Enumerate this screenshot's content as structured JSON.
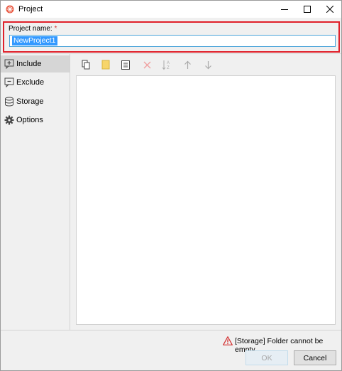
{
  "window": {
    "title": "Project",
    "icon": "app-logo-icon",
    "controls": [
      "minimize-icon",
      "maximize-icon",
      "close-icon"
    ]
  },
  "project_name": {
    "label": "Project name:",
    "required_mark": "*",
    "value": "NewProject1"
  },
  "sidebar": {
    "items": [
      {
        "label": "Include",
        "icon": "include-icon",
        "selected": true
      },
      {
        "label": "Exclude",
        "icon": "exclude-icon",
        "selected": false
      },
      {
        "label": "Storage",
        "icon": "storage-icon",
        "selected": false
      },
      {
        "label": "Options",
        "icon": "gear-icon",
        "selected": false
      }
    ]
  },
  "toolbar": {
    "tools": [
      "copy-icon",
      "folder-icon",
      "list-icon",
      "delete-icon",
      "sort-az-icon",
      "move-up-icon",
      "move-down-icon"
    ]
  },
  "status": {
    "warning_text": "[Storage] Folder cannot be empty",
    "warning_color": "#d32f2f"
  },
  "buttons": {
    "ok_label": "OK",
    "cancel_label": "Cancel"
  },
  "colors": {
    "highlight_border": "#e0202a",
    "selection": "#3399ff",
    "input_border": "#4aa3d9"
  }
}
